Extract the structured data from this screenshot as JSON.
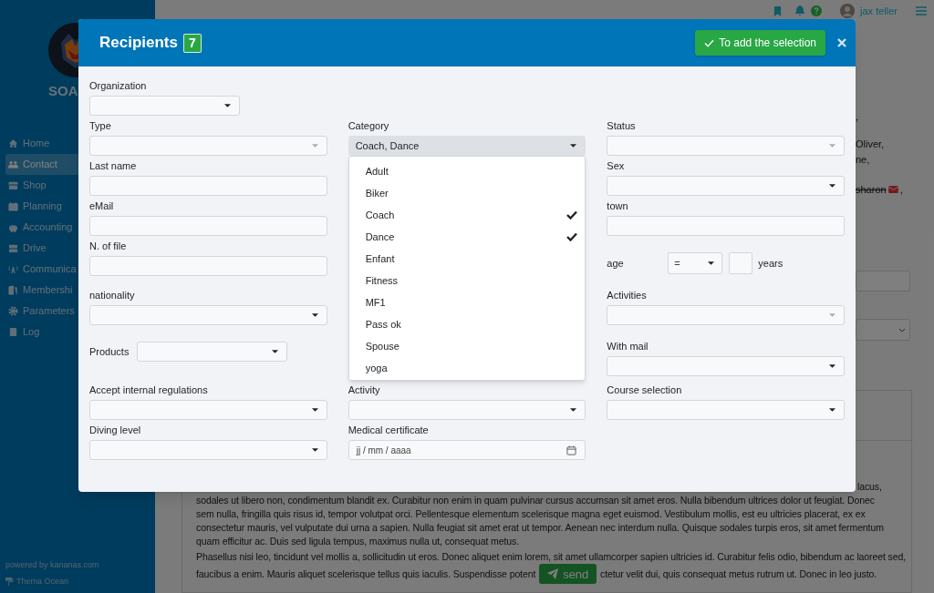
{
  "topbar": {
    "user": "jax teller"
  },
  "sidebar": {
    "brand": "SOA",
    "items": [
      {
        "label": "Home",
        "selected": false
      },
      {
        "label": "Contact",
        "selected": true
      },
      {
        "label": "Shop",
        "selected": false
      },
      {
        "label": "Planning",
        "selected": false
      },
      {
        "label": "Accounting",
        "selected": false
      },
      {
        "label": "Drive",
        "selected": false
      },
      {
        "label": "Communica",
        "selected": false
      },
      {
        "label": "Membershi",
        "selected": false
      },
      {
        "label": "Parameters",
        "selected": false
      },
      {
        "label": "Log",
        "selected": false
      }
    ],
    "powered": "powered by kananas.com",
    "theme": "Thema Ocean"
  },
  "background": {
    "fragments": [
      ",",
      "Oliver,",
      "ne,"
    ],
    "struck_name": "sharon",
    "struck_tail": ",",
    "paragraph_1_tail": "lacus,",
    "paragraph_1": "sodales ut libero non, condimentum blandit ex. Curabitur non enim in quam pulvinar cursus accumsan sit amet eros. Nulla bibendum ultrices dolor ut feugiat. Donec sem nulla, fringilla quis risus id, tempor volutpat orci. Pellentesque elementum scelerisque magna eget euismod. Vestibulum mollis, est eu ultricies placerat, ex ex consectetur mauris, vel vulputate dui urna a sapien. Nulla feugiat sit amet erat ut tempor. Aenean nec interdum nulla. Quisque sodales turpis eros, sit amet fermentum quam efficitur ac. Duis sed ligula tempus, maximus nulla ut, consequat metus.",
    "paragraph_2": "Phasellus nisi leo, tincidunt vel mollis a, sollicitudin ut eros. Donec aliquet enim lorem, sit amet ullamcorper sapien ultricies id. Curabitur felis odio, bibendum ac laoreet sed,",
    "paragraph_2_before": "faucibus a enim. Mauris aliquet scelerisque tellus quis iaculis. Suspendisse potent",
    "paragraph_2_after": "ctetur velit dui, quis consequat metus rutrum ut. Donec in leo justo.",
    "send_button": "send"
  },
  "modal": {
    "title": "Recipients",
    "count": "7",
    "add_button": "To add the selection",
    "rows": [
      {
        "left": {
          "kind": "short-select",
          "label": "Organization"
        }
      },
      {
        "left": {
          "kind": "multiselect",
          "label": "Type",
          "open": false
        },
        "middle": {
          "kind": "multiselect",
          "label": "Category",
          "open": true,
          "value": "Coach, Dance",
          "options": [
            {
              "label": "Adult",
              "checked": false
            },
            {
              "label": "Biker",
              "checked": false
            },
            {
              "label": "Coach",
              "checked": true
            },
            {
              "label": "Dance",
              "checked": true
            },
            {
              "label": "Enfant",
              "checked": false
            },
            {
              "label": "Fitness",
              "checked": false
            },
            {
              "label": "MF1",
              "checked": false
            },
            {
              "label": "Pass ok",
              "checked": false
            },
            {
              "label": "Spouse",
              "checked": false
            },
            {
              "label": "yoga",
              "checked": false
            }
          ]
        },
        "right": {
          "kind": "multiselect",
          "label": "Status",
          "open": false
        }
      },
      {
        "left": {
          "kind": "text",
          "label": "Last name"
        },
        "right": {
          "kind": "select",
          "label": "Sex"
        }
      },
      {
        "left": {
          "kind": "text",
          "label": "eMail"
        },
        "right": {
          "kind": "text",
          "label": "town"
        }
      },
      {
        "left": {
          "kind": "text",
          "label": "N. of file"
        },
        "right": {
          "kind": "age",
          "label": "age",
          "operator": "=",
          "unit": "years"
        }
      },
      {
        "left": {
          "kind": "select",
          "label": "nationality"
        },
        "right": {
          "kind": "multiselect",
          "label": "Activities",
          "open": false
        }
      },
      {
        "left": {
          "kind": "inline-select",
          "label": "Products"
        },
        "right": {
          "kind": "select",
          "label": "With mail"
        }
      },
      {
        "left": {
          "kind": "select",
          "label": "Accept internal regulations"
        },
        "middle": {
          "kind": "select",
          "label": "Activity"
        },
        "right": {
          "kind": "select",
          "label": "Course selection"
        }
      },
      {
        "left": {
          "kind": "select",
          "label": "Diving level"
        },
        "middle": {
          "kind": "date",
          "label": "Medical certificate",
          "placeholder": "jj / mm / aaaa"
        }
      }
    ]
  }
}
